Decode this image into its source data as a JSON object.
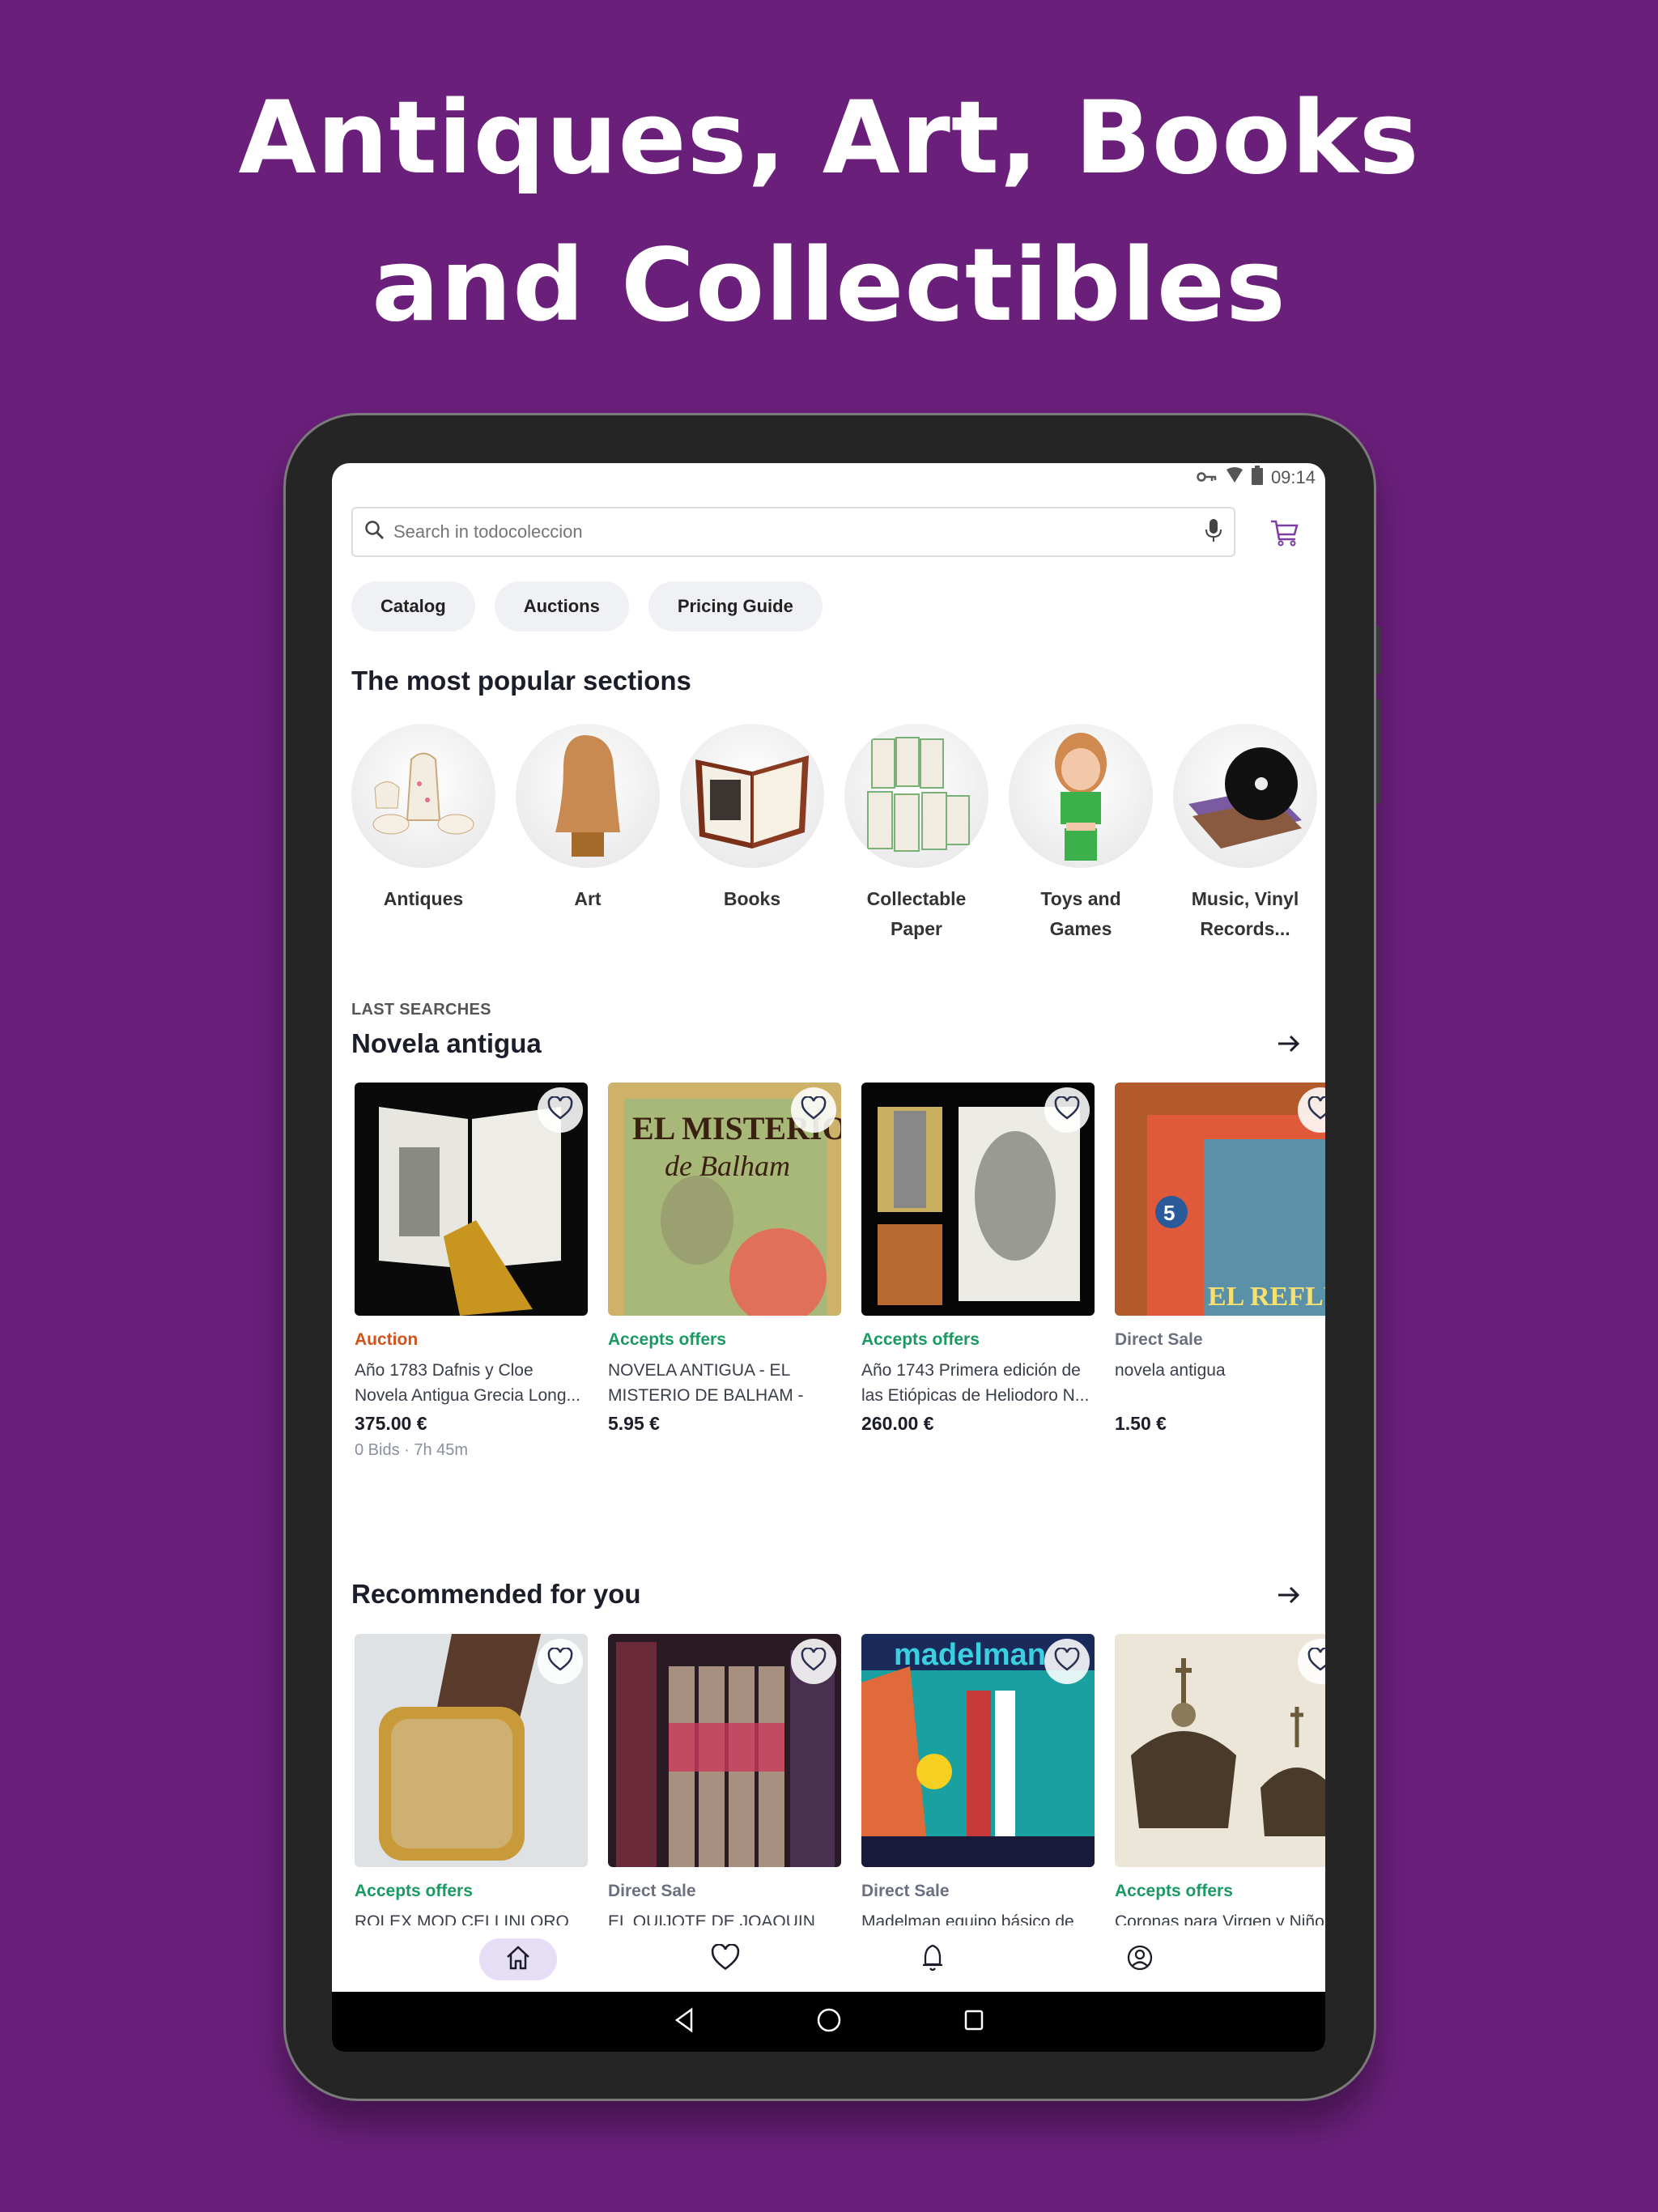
{
  "headline": [
    "Antiques, Art, Books",
    "and Collectibles"
  ],
  "colors": {
    "background": "#6a1f7a",
    "accent": "#7a3fa0",
    "auction": "#d2521c",
    "offers": "#1a9a62",
    "direct": "#6b6f80"
  },
  "status_bar": {
    "time": "09:14",
    "icons": [
      "vpn-key-icon",
      "wifi-icon",
      "battery-icon"
    ]
  },
  "search": {
    "placeholder": "Search in todocoleccion",
    "value": ""
  },
  "chips": [
    "Catalog",
    "Auctions",
    "Pricing Guide"
  ],
  "popular": {
    "title": "The most popular sections",
    "categories": [
      {
        "label": "Antiques"
      },
      {
        "label": "Art"
      },
      {
        "label": "Books"
      },
      {
        "label": "Collectable Paper"
      },
      {
        "label": "Toys and Games"
      },
      {
        "label": "Music, Vinyl Records..."
      }
    ]
  },
  "last_searches": {
    "overline": "LAST SEARCHES",
    "title": "Novela antigua",
    "items": [
      {
        "tag": "Auction",
        "type": "auction",
        "title": "Año 1783 Dafnis y Cloe Novela Antigua Grecia Long...",
        "price": "375.00 €",
        "meta": "0 Bids · 7h 45m"
      },
      {
        "tag": "Accepts offers",
        "type": "offers",
        "title": "NOVELA ANTIGUA - EL MISTERIO DE BALHAM - SYD...",
        "price": "5.95 €",
        "meta": ""
      },
      {
        "tag": "Accepts offers",
        "type": "offers",
        "title": "Año 1743 Primera edición de las Etiópicas de Heliodoro N...",
        "price": "260.00 €",
        "meta": ""
      },
      {
        "tag": "Direct Sale",
        "type": "direct",
        "title": "novela antigua",
        "price": "1.50 €",
        "meta": ""
      }
    ]
  },
  "recommended": {
    "title": "Recommended for you",
    "items": [
      {
        "tag": "Accepts offers",
        "type": "offers",
        "title": "ROLEX MOD CELLINI ORO"
      },
      {
        "tag": "Direct Sale",
        "type": "direct",
        "title": "EL QUIJOTE DE JOAQUIN"
      },
      {
        "tag": "Direct Sale",
        "type": "direct",
        "title": "Madelman equipo básico de"
      },
      {
        "tag": "Accepts offers",
        "type": "offers",
        "title": "Coronas para Virgen y Niño"
      }
    ]
  },
  "bottom_nav": [
    {
      "name": "home",
      "icon": "home-icon",
      "active": true
    },
    {
      "name": "favorites",
      "icon": "heart-icon",
      "active": false
    },
    {
      "name": "notifications",
      "icon": "bell-icon",
      "active": false
    },
    {
      "name": "profile",
      "icon": "account-icon",
      "active": false
    }
  ],
  "system_nav": [
    "back",
    "home",
    "recents"
  ]
}
